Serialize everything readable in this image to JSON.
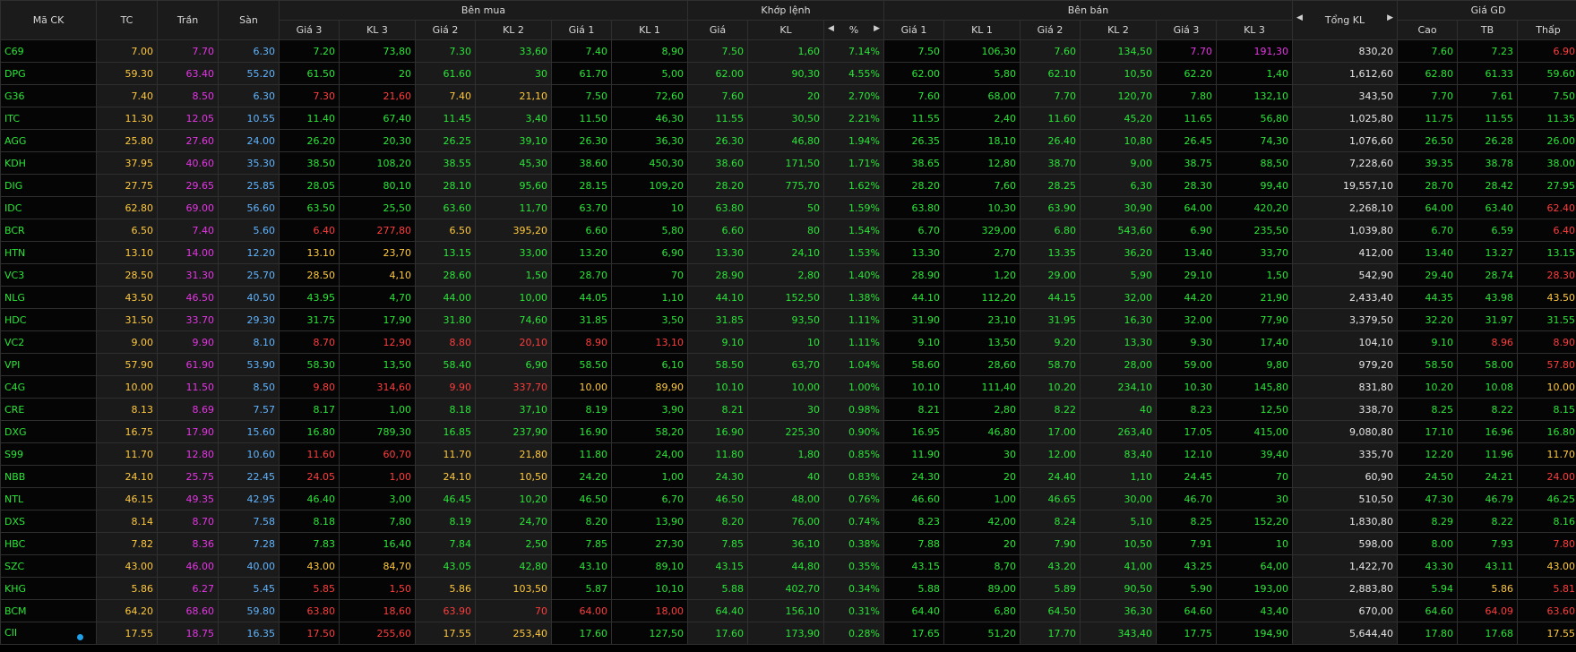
{
  "headers": {
    "symbol": "Mã CK",
    "ref": "TC",
    "ceil": "Trần",
    "floor": "Sàn",
    "buy_group": "Bên mua",
    "match_group": "Khớp lệnh",
    "sell_group": "Bên bán",
    "total_vol": "Tổng KL",
    "price_group": "Giá GD",
    "buy_cols": [
      "Giá 3",
      "KL 3",
      "Giá 2",
      "KL 2",
      "Giá 1",
      "KL 1"
    ],
    "match_price": "Giá",
    "match_vol": "KL",
    "match_pct": "%",
    "sell_cols": [
      "Giá 1",
      "KL 1",
      "Giá 2",
      "KL 2",
      "Giá 3",
      "KL 3"
    ],
    "high": "Cao",
    "avg": "TB",
    "low": "Thấp"
  },
  "icons": {
    "arrow_left": "◀",
    "arrow_right": "▶"
  },
  "colors": {
    "up": "#29e637",
    "down": "#ff3d3d",
    "ref": "#ffc93c",
    "ceil": "#e535e5",
    "floor": "#5fb4ff"
  },
  "rows": [
    {
      "sym": "C69",
      "tc": "7.00",
      "tran": "7.70",
      "san": "6.30",
      "bg3": "7.20",
      "bk3": "73,80",
      "bg2": "7.30",
      "bk2": "33,60",
      "bg1": "7.40",
      "bk1": "8,90",
      "mp": "7.50",
      "mv": "1,60",
      "pct": "7.14%",
      "sg1": "7.50",
      "sk1": "106,30",
      "sg2": "7.60",
      "sk2": "134,50",
      "sg3": "7.70",
      "sk3": "191,30",
      "tot": "830,20",
      "hi": "7.60",
      "avg": "7.23",
      "lo": "6.90",
      "dot": false
    },
    {
      "sym": "DPG",
      "tc": "59.30",
      "tran": "63.40",
      "san": "55.20",
      "bg3": "61.50",
      "bk3": "20",
      "bg2": "61.60",
      "bk2": "30",
      "bg1": "61.70",
      "bk1": "5,00",
      "mp": "62.00",
      "mv": "90,30",
      "pct": "4.55%",
      "sg1": "62.00",
      "sk1": "5,80",
      "sg2": "62.10",
      "sk2": "10,50",
      "sg3": "62.20",
      "sk3": "1,40",
      "tot": "1,612,60",
      "hi": "62.80",
      "avg": "61.33",
      "lo": "59.60",
      "dot": false
    },
    {
      "sym": "G36",
      "tc": "7.40",
      "tran": "8.50",
      "san": "6.30",
      "bg3": "7.30",
      "bk3": "21,60",
      "bg2": "7.40",
      "bk2": "21,10",
      "bg1": "7.50",
      "bk1": "72,60",
      "mp": "7.60",
      "mv": "20",
      "pct": "2.70%",
      "sg1": "7.60",
      "sk1": "68,00",
      "sg2": "7.70",
      "sk2": "120,70",
      "sg3": "7.80",
      "sk3": "132,10",
      "tot": "343,50",
      "hi": "7.70",
      "avg": "7.61",
      "lo": "7.50",
      "dot": false
    },
    {
      "sym": "ITC",
      "tc": "11.30",
      "tran": "12.05",
      "san": "10.55",
      "bg3": "11.40",
      "bk3": "67,40",
      "bg2": "11.45",
      "bk2": "3,40",
      "bg1": "11.50",
      "bk1": "46,30",
      "mp": "11.55",
      "mv": "30,50",
      "pct": "2.21%",
      "sg1": "11.55",
      "sk1": "2,40",
      "sg2": "11.60",
      "sk2": "45,20",
      "sg3": "11.65",
      "sk3": "56,80",
      "tot": "1,025,80",
      "hi": "11.75",
      "avg": "11.55",
      "lo": "11.35",
      "dot": false
    },
    {
      "sym": "AGG",
      "tc": "25.80",
      "tran": "27.60",
      "san": "24.00",
      "bg3": "26.20",
      "bk3": "20,30",
      "bg2": "26.25",
      "bk2": "39,10",
      "bg1": "26.30",
      "bk1": "36,30",
      "mp": "26.30",
      "mv": "46,80",
      "pct": "1.94%",
      "sg1": "26.35",
      "sk1": "18,10",
      "sg2": "26.40",
      "sk2": "10,80",
      "sg3": "26.45",
      "sk3": "74,30",
      "tot": "1,076,60",
      "hi": "26.50",
      "avg": "26.28",
      "lo": "26.00",
      "dot": false
    },
    {
      "sym": "KDH",
      "tc": "37.95",
      "tran": "40.60",
      "san": "35.30",
      "bg3": "38.50",
      "bk3": "108,20",
      "bg2": "38.55",
      "bk2": "45,30",
      "bg1": "38.60",
      "bk1": "450,30",
      "mp": "38.60",
      "mv": "171,50",
      "pct": "1.71%",
      "sg1": "38.65",
      "sk1": "12,80",
      "sg2": "38.70",
      "sk2": "9,00",
      "sg3": "38.75",
      "sk3": "88,50",
      "tot": "7,228,60",
      "hi": "39.35",
      "avg": "38.78",
      "lo": "38.00",
      "dot": false
    },
    {
      "sym": "DIG",
      "tc": "27.75",
      "tran": "29.65",
      "san": "25.85",
      "bg3": "28.05",
      "bk3": "80,10",
      "bg2": "28.10",
      "bk2": "95,60",
      "bg1": "28.15",
      "bk1": "109,20",
      "mp": "28.20",
      "mv": "775,70",
      "pct": "1.62%",
      "sg1": "28.20",
      "sk1": "7,60",
      "sg2": "28.25",
      "sk2": "6,30",
      "sg3": "28.30",
      "sk3": "99,40",
      "tot": "19,557,10",
      "hi": "28.70",
      "avg": "28.42",
      "lo": "27.95",
      "dot": false
    },
    {
      "sym": "IDC",
      "tc": "62.80",
      "tran": "69.00",
      "san": "56.60",
      "bg3": "63.50",
      "bk3": "25,50",
      "bg2": "63.60",
      "bk2": "11,70",
      "bg1": "63.70",
      "bk1": "10",
      "mp": "63.80",
      "mv": "50",
      "pct": "1.59%",
      "sg1": "63.80",
      "sk1": "10,30",
      "sg2": "63.90",
      "sk2": "30,90",
      "sg3": "64.00",
      "sk3": "420,20",
      "tot": "2,268,10",
      "hi": "64.00",
      "avg": "63.40",
      "lo": "62.40",
      "dot": false
    },
    {
      "sym": "BCR",
      "tc": "6.50",
      "tran": "7.40",
      "san": "5.60",
      "bg3": "6.40",
      "bk3": "277,80",
      "bg2": "6.50",
      "bk2": "395,20",
      "bg1": "6.60",
      "bk1": "5,80",
      "mp": "6.60",
      "mv": "80",
      "pct": "1.54%",
      "sg1": "6.70",
      "sk1": "329,00",
      "sg2": "6.80",
      "sk2": "543,60",
      "sg3": "6.90",
      "sk3": "235,50",
      "tot": "1,039,80",
      "hi": "6.70",
      "avg": "6.59",
      "lo": "6.40",
      "dot": false
    },
    {
      "sym": "HTN",
      "tc": "13.10",
      "tran": "14.00",
      "san": "12.20",
      "bg3": "13.10",
      "bk3": "23,70",
      "bg2": "13.15",
      "bk2": "33,00",
      "bg1": "13.20",
      "bk1": "6,90",
      "mp": "13.30",
      "mv": "24,10",
      "pct": "1.53%",
      "sg1": "13.30",
      "sk1": "2,70",
      "sg2": "13.35",
      "sk2": "36,20",
      "sg3": "13.40",
      "sk3": "33,70",
      "tot": "412,00",
      "hi": "13.40",
      "avg": "13.27",
      "lo": "13.15",
      "dot": false
    },
    {
      "sym": "VC3",
      "tc": "28.50",
      "tran": "31.30",
      "san": "25.70",
      "bg3": "28.50",
      "bk3": "4,10",
      "bg2": "28.60",
      "bk2": "1,50",
      "bg1": "28.70",
      "bk1": "70",
      "mp": "28.90",
      "mv": "2,80",
      "pct": "1.40%",
      "sg1": "28.90",
      "sk1": "1,20",
      "sg2": "29.00",
      "sk2": "5,90",
      "sg3": "29.10",
      "sk3": "1,50",
      "tot": "542,90",
      "hi": "29.40",
      "avg": "28.74",
      "lo": "28.30",
      "dot": false
    },
    {
      "sym": "NLG",
      "tc": "43.50",
      "tran": "46.50",
      "san": "40.50",
      "bg3": "43.95",
      "bk3": "4,70",
      "bg2": "44.00",
      "bk2": "10,00",
      "bg1": "44.05",
      "bk1": "1,10",
      "mp": "44.10",
      "mv": "152,50",
      "pct": "1.38%",
      "sg1": "44.10",
      "sk1": "112,20",
      "sg2": "44.15",
      "sk2": "32,00",
      "sg3": "44.20",
      "sk3": "21,90",
      "tot": "2,433,40",
      "hi": "44.35",
      "avg": "43.98",
      "lo": "43.50",
      "dot": false
    },
    {
      "sym": "HDC",
      "tc": "31.50",
      "tran": "33.70",
      "san": "29.30",
      "bg3": "31.75",
      "bk3": "17,90",
      "bg2": "31.80",
      "bk2": "74,60",
      "bg1": "31.85",
      "bk1": "3,50",
      "mp": "31.85",
      "mv": "93,50",
      "pct": "1.11%",
      "sg1": "31.90",
      "sk1": "23,10",
      "sg2": "31.95",
      "sk2": "16,30",
      "sg3": "32.00",
      "sk3": "77,90",
      "tot": "3,379,50",
      "hi": "32.20",
      "avg": "31.97",
      "lo": "31.55",
      "dot": false
    },
    {
      "sym": "VC2",
      "tc": "9.00",
      "tran": "9.90",
      "san": "8.10",
      "bg3": "8.70",
      "bk3": "12,90",
      "bg2": "8.80",
      "bk2": "20,10",
      "bg1": "8.90",
      "bk1": "13,10",
      "mp": "9.10",
      "mv": "10",
      "pct": "1.11%",
      "sg1": "9.10",
      "sk1": "13,50",
      "sg2": "9.20",
      "sk2": "13,30",
      "sg3": "9.30",
      "sk3": "17,40",
      "tot": "104,10",
      "hi": "9.10",
      "avg": "8.96",
      "lo": "8.90",
      "dot": false
    },
    {
      "sym": "VPI",
      "tc": "57.90",
      "tran": "61.90",
      "san": "53.90",
      "bg3": "58.30",
      "bk3": "13,50",
      "bg2": "58.40",
      "bk2": "6,90",
      "bg1": "58.50",
      "bk1": "6,10",
      "mp": "58.50",
      "mv": "63,70",
      "pct": "1.04%",
      "sg1": "58.60",
      "sk1": "28,60",
      "sg2": "58.70",
      "sk2": "28,00",
      "sg3": "59.00",
      "sk3": "9,80",
      "tot": "979,20",
      "hi": "58.50",
      "avg": "58.00",
      "lo": "57.80",
      "dot": false
    },
    {
      "sym": "C4G",
      "tc": "10.00",
      "tran": "11.50",
      "san": "8.50",
      "bg3": "9.80",
      "bk3": "314,60",
      "bg2": "9.90",
      "bk2": "337,70",
      "bg1": "10.00",
      "bk1": "89,90",
      "mp": "10.10",
      "mv": "10,00",
      "pct": "1.00%",
      "sg1": "10.10",
      "sk1": "111,40",
      "sg2": "10.20",
      "sk2": "234,10",
      "sg3": "10.30",
      "sk3": "145,80",
      "tot": "831,80",
      "hi": "10.20",
      "avg": "10.08",
      "lo": "10.00",
      "dot": false
    },
    {
      "sym": "CRE",
      "tc": "8.13",
      "tran": "8.69",
      "san": "7.57",
      "bg3": "8.17",
      "bk3": "1,00",
      "bg2": "8.18",
      "bk2": "37,10",
      "bg1": "8.19",
      "bk1": "3,90",
      "mp": "8.21",
      "mv": "30",
      "pct": "0.98%",
      "sg1": "8.21",
      "sk1": "2,80",
      "sg2": "8.22",
      "sk2": "40",
      "sg3": "8.23",
      "sk3": "12,50",
      "tot": "338,70",
      "hi": "8.25",
      "avg": "8.22",
      "lo": "8.15",
      "dot": false
    },
    {
      "sym": "DXG",
      "tc": "16.75",
      "tran": "17.90",
      "san": "15.60",
      "bg3": "16.80",
      "bk3": "789,30",
      "bg2": "16.85",
      "bk2": "237,90",
      "bg1": "16.90",
      "bk1": "58,20",
      "mp": "16.90",
      "mv": "225,30",
      "pct": "0.90%",
      "sg1": "16.95",
      "sk1": "46,80",
      "sg2": "17.00",
      "sk2": "263,40",
      "sg3": "17.05",
      "sk3": "415,00",
      "tot": "9,080,80",
      "hi": "17.10",
      "avg": "16.96",
      "lo": "16.80",
      "dot": false
    },
    {
      "sym": "S99",
      "tc": "11.70",
      "tran": "12.80",
      "san": "10.60",
      "bg3": "11.60",
      "bk3": "60,70",
      "bg2": "11.70",
      "bk2": "21,80",
      "bg1": "11.80",
      "bk1": "24,00",
      "mp": "11.80",
      "mv": "1,80",
      "pct": "0.85%",
      "sg1": "11.90",
      "sk1": "30",
      "sg2": "12.00",
      "sk2": "83,40",
      "sg3": "12.10",
      "sk3": "39,40",
      "tot": "335,70",
      "hi": "12.20",
      "avg": "11.96",
      "lo": "11.70",
      "dot": false
    },
    {
      "sym": "NBB",
      "tc": "24.10",
      "tran": "25.75",
      "san": "22.45",
      "bg3": "24.05",
      "bk3": "1,00",
      "bg2": "24.10",
      "bk2": "10,50",
      "bg1": "24.20",
      "bk1": "1,00",
      "mp": "24.30",
      "mv": "40",
      "pct": "0.83%",
      "sg1": "24.30",
      "sk1": "20",
      "sg2": "24.40",
      "sk2": "1,10",
      "sg3": "24.45",
      "sk3": "70",
      "tot": "60,90",
      "hi": "24.50",
      "avg": "24.21",
      "lo": "24.00",
      "dot": false
    },
    {
      "sym": "NTL",
      "tc": "46.15",
      "tran": "49.35",
      "san": "42.95",
      "bg3": "46.40",
      "bk3": "3,00",
      "bg2": "46.45",
      "bk2": "10,20",
      "bg1": "46.50",
      "bk1": "6,70",
      "mp": "46.50",
      "mv": "48,00",
      "pct": "0.76%",
      "sg1": "46.60",
      "sk1": "1,00",
      "sg2": "46.65",
      "sk2": "30,00",
      "sg3": "46.70",
      "sk3": "30",
      "tot": "510,50",
      "hi": "47.30",
      "avg": "46.79",
      "lo": "46.25",
      "dot": false
    },
    {
      "sym": "DXS",
      "tc": "8.14",
      "tran": "8.70",
      "san": "7.58",
      "bg3": "8.18",
      "bk3": "7,80",
      "bg2": "8.19",
      "bk2": "24,70",
      "bg1": "8.20",
      "bk1": "13,90",
      "mp": "8.20",
      "mv": "76,00",
      "pct": "0.74%",
      "sg1": "8.23",
      "sk1": "42,00",
      "sg2": "8.24",
      "sk2": "5,10",
      "sg3": "8.25",
      "sk3": "152,20",
      "tot": "1,830,80",
      "hi": "8.29",
      "avg": "8.22",
      "lo": "8.16",
      "dot": false
    },
    {
      "sym": "HBC",
      "tc": "7.82",
      "tran": "8.36",
      "san": "7.28",
      "bg3": "7.83",
      "bk3": "16,40",
      "bg2": "7.84",
      "bk2": "2,50",
      "bg1": "7.85",
      "bk1": "27,30",
      "mp": "7.85",
      "mv": "36,10",
      "pct": "0.38%",
      "sg1": "7.88",
      "sk1": "20",
      "sg2": "7.90",
      "sk2": "10,50",
      "sg3": "7.91",
      "sk3": "10",
      "tot": "598,00",
      "hi": "8.00",
      "avg": "7.93",
      "lo": "7.80",
      "dot": false
    },
    {
      "sym": "SZC",
      "tc": "43.00",
      "tran": "46.00",
      "san": "40.00",
      "bg3": "43.00",
      "bk3": "84,70",
      "bg2": "43.05",
      "bk2": "42,80",
      "bg1": "43.10",
      "bk1": "89,10",
      "mp": "43.15",
      "mv": "44,80",
      "pct": "0.35%",
      "sg1": "43.15",
      "sk1": "8,70",
      "sg2": "43.20",
      "sk2": "41,00",
      "sg3": "43.25",
      "sk3": "64,00",
      "tot": "1,422,70",
      "hi": "43.30",
      "avg": "43.11",
      "lo": "43.00",
      "dot": false
    },
    {
      "sym": "KHG",
      "tc": "5.86",
      "tran": "6.27",
      "san": "5.45",
      "bg3": "5.85",
      "bk3": "1,50",
      "bg2": "5.86",
      "bk2": "103,50",
      "bg1": "5.87",
      "bk1": "10,10",
      "mp": "5.88",
      "mv": "402,70",
      "pct": "0.34%",
      "sg1": "5.88",
      "sk1": "89,00",
      "sg2": "5.89",
      "sk2": "90,50",
      "sg3": "5.90",
      "sk3": "193,00",
      "tot": "2,883,80",
      "hi": "5.94",
      "avg": "5.86",
      "lo": "5.81",
      "dot": false
    },
    {
      "sym": "BCM",
      "tc": "64.20",
      "tran": "68.60",
      "san": "59.80",
      "bg3": "63.80",
      "bk3": "18,60",
      "bg2": "63.90",
      "bk2": "70",
      "bg1": "64.00",
      "bk1": "18,00",
      "mp": "64.40",
      "mv": "156,10",
      "pct": "0.31%",
      "sg1": "64.40",
      "sk1": "6,80",
      "sg2": "64.50",
      "sk2": "36,30",
      "sg3": "64.60",
      "sk3": "43,40",
      "tot": "670,00",
      "hi": "64.60",
      "avg": "64.09",
      "lo": "63.60",
      "dot": false
    },
    {
      "sym": "CII",
      "tc": "17.55",
      "tran": "18.75",
      "san": "16.35",
      "bg3": "17.50",
      "bk3": "255,60",
      "bg2": "17.55",
      "bk2": "253,40",
      "bg1": "17.60",
      "bk1": "127,50",
      "mp": "17.60",
      "mv": "173,90",
      "pct": "0.28%",
      "sg1": "17.65",
      "sk1": "51,20",
      "sg2": "17.70",
      "sk2": "343,40",
      "sg3": "17.75",
      "sk3": "194,90",
      "tot": "5,644,40",
      "hi": "17.80",
      "avg": "17.68",
      "lo": "17.55",
      "dot": true
    }
  ]
}
